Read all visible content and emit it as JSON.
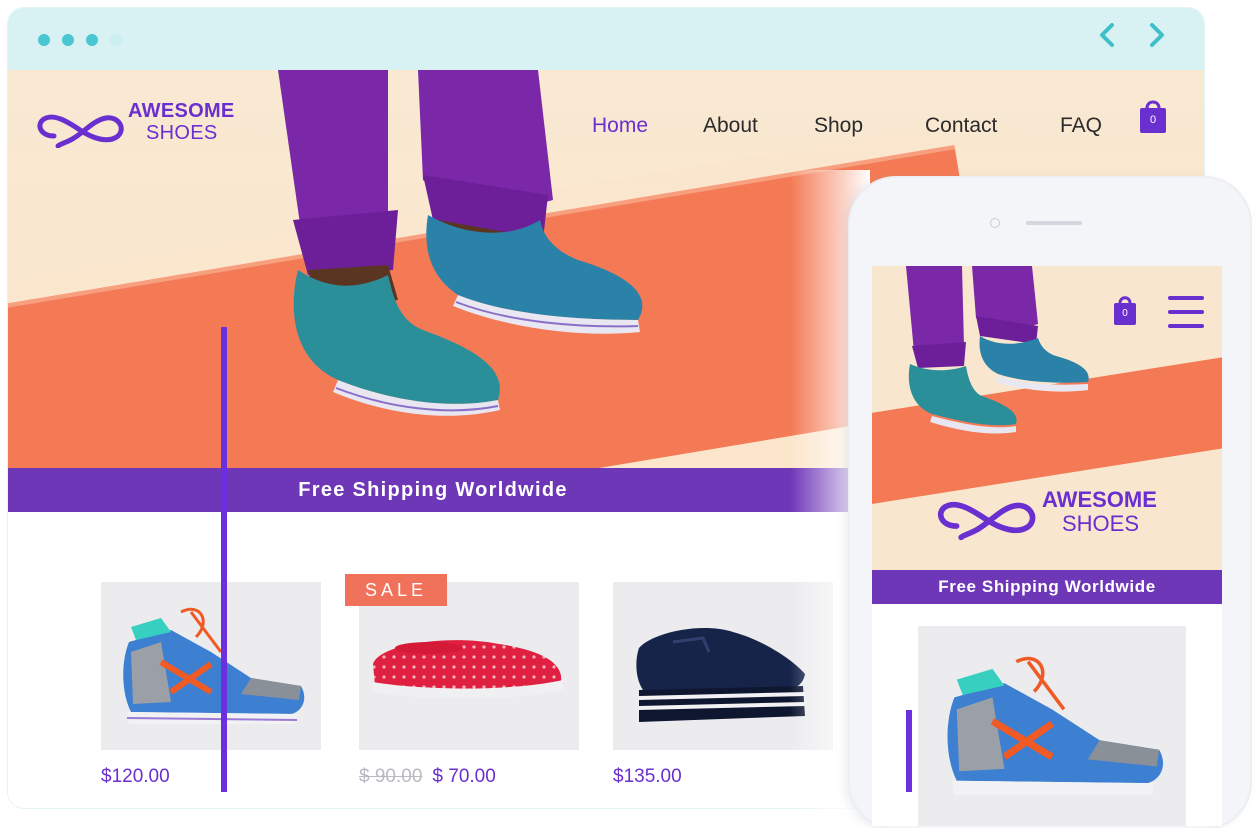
{
  "browser": {
    "nav_prev": "‹",
    "nav_next": "›"
  },
  "logo": {
    "line1": "AWESOME",
    "line2": "SHOES"
  },
  "nav": {
    "items": [
      {
        "label": "Home",
        "active": true
      },
      {
        "label": "About"
      },
      {
        "label": "Shop"
      },
      {
        "label": "Contact"
      },
      {
        "label": "FAQ"
      }
    ],
    "cart_count": "0"
  },
  "banner": {
    "text": "Free Shipping Worldwide"
  },
  "products": [
    {
      "price": "$120.00",
      "sale": false,
      "image": "high-top-sneaker"
    },
    {
      "old_price": "$ 90.00",
      "price": "$ 70.00",
      "sale": true,
      "badge": "SALE",
      "image": "red-slip-on"
    },
    {
      "price": "$135.00",
      "sale": false,
      "image": "platform-sneaker"
    }
  ],
  "mobile": {
    "cart_count": "0",
    "logo": {
      "line1": "AWESOME",
      "line2": "SHOES"
    },
    "banner": "Free Shipping Worldwide"
  },
  "colors": {
    "brand_purple": "#6a2fcf",
    "banner_purple": "#6d37b8",
    "coral": "#f47a55",
    "browser_bar": "#d8f2f4",
    "teal": "#49c6cf"
  }
}
